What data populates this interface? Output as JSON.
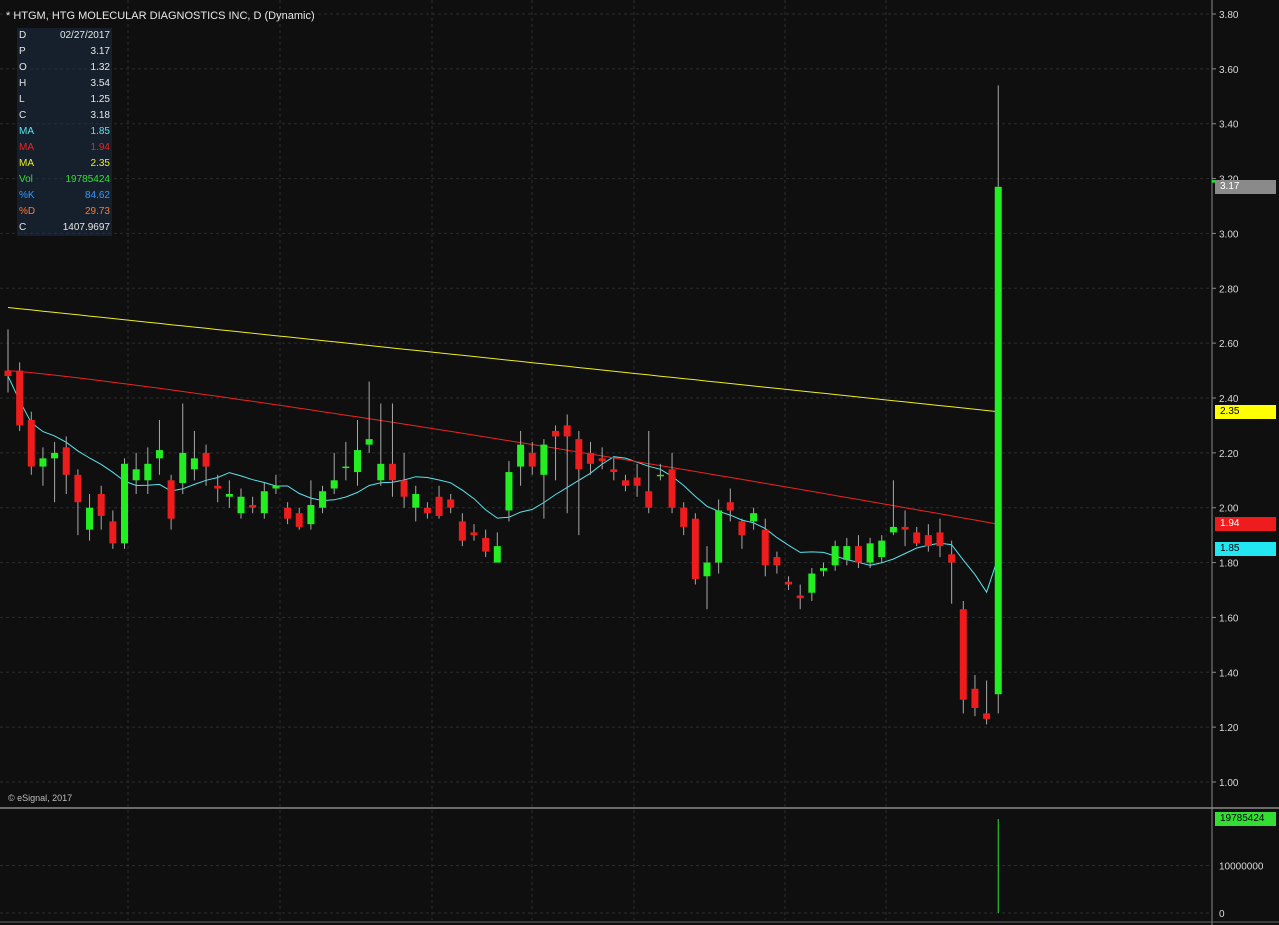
{
  "header": {
    "title": "* HTGM, HTG MOLECULAR DIAGNOSTICS INC, D (Dynamic)",
    "copyright": "© eSignal, 2017"
  },
  "info_panel": [
    {
      "label": "D",
      "value": "02/27/2017",
      "label_color": "#e6e6e6",
      "value_color": "#e6e6e6"
    },
    {
      "label": "P",
      "value": "3.17",
      "label_color": "#e6e6e6",
      "value_color": "#e6e6e6"
    },
    {
      "label": "O",
      "value": "1.32",
      "label_color": "#e6e6e6",
      "value_color": "#e6e6e6"
    },
    {
      "label": "H",
      "value": "3.54",
      "label_color": "#e6e6e6",
      "value_color": "#e6e6e6"
    },
    {
      "label": "L",
      "value": "1.25",
      "label_color": "#e6e6e6",
      "value_color": "#e6e6e6"
    },
    {
      "label": "C",
      "value": "3.18",
      "label_color": "#e6e6e6",
      "value_color": "#e6e6e6"
    },
    {
      "label": "MA",
      "value": "1.85",
      "label_color": "#55e6ee",
      "value_color": "#55e6ee"
    },
    {
      "label": "MA",
      "value": "1.94",
      "label_color": "#ee2222",
      "value_color": "#ee2222"
    },
    {
      "label": "MA",
      "value": "2.35",
      "label_color": "#eeee22",
      "value_color": "#eeee22"
    },
    {
      "label": "Vol",
      "value": "19785424",
      "label_color": "#33dd33",
      "value_color": "#33dd33"
    },
    {
      "label": "%K",
      "value": "84.62",
      "label_color": "#3399ff",
      "value_color": "#3399ff"
    },
    {
      "label": "%D",
      "value": "29.73",
      "label_color": "#ff7733",
      "value_color": "#ff7733"
    },
    {
      "label": "C",
      "value": "1407.9697",
      "label_color": "#e6e6e6",
      "value_color": "#e6e6e6"
    }
  ],
  "price_tags": [
    {
      "label": "3.17",
      "value": 3.17,
      "bg": "#8a8a8a",
      "fg": "#ffffff"
    },
    {
      "label": "2.35",
      "value": 2.35,
      "bg": "#ffff00",
      "fg": "#000000"
    },
    {
      "label": "1.94",
      "value": 1.94,
      "bg": "#ee1c1c",
      "fg": "#ffffff"
    },
    {
      "label": "1.85",
      "value": 1.85,
      "bg": "#22e6f2",
      "fg": "#000000"
    }
  ],
  "volume_tag": {
    "label": "19785424",
    "value": 19785424,
    "bg": "#33dd33",
    "fg": "#000000"
  },
  "colors": {
    "up": "#22ee22",
    "down": "#ee1c1c",
    "ma_short": "#55e6ee",
    "ma_mid": "#ee2222",
    "ma_long": "#eeee22",
    "volume": "#33dd33"
  },
  "chart_data": {
    "type": "candlestick",
    "price_axis": {
      "min": 1.0,
      "max": 3.8,
      "ticks": [
        "1.00",
        "1.20",
        "1.40",
        "1.60",
        "1.80",
        "2.00",
        "2.20",
        "2.40",
        "2.60",
        "2.80",
        "3.00",
        "3.20",
        "3.40",
        "3.60",
        "3.80"
      ]
    },
    "volume_axis": {
      "min": 0,
      "max": 20000000,
      "ticks": [
        "0",
        "10000000"
      ]
    },
    "grid": true,
    "candles": [
      [
        2.5,
        2.48,
        2.65,
        2.42
      ],
      [
        2.5,
        2.3,
        2.53,
        2.28
      ],
      [
        2.32,
        2.15,
        2.35,
        2.12
      ],
      [
        2.15,
        2.18,
        2.22,
        2.08
      ],
      [
        2.18,
        2.2,
        2.24,
        2.02
      ],
      [
        2.22,
        2.12,
        2.26,
        2.05
      ],
      [
        2.12,
        2.02,
        2.14,
        1.9
      ],
      [
        1.92,
        2.0,
        2.05,
        1.88
      ],
      [
        2.05,
        1.97,
        2.08,
        1.92
      ],
      [
        1.95,
        1.87,
        1.99,
        1.85
      ],
      [
        1.87,
        2.16,
        2.18,
        1.85
      ],
      [
        2.1,
        2.14,
        2.2,
        2.05
      ],
      [
        2.1,
        2.16,
        2.22,
        2.05
      ],
      [
        2.18,
        2.21,
        2.32,
        2.12
      ],
      [
        2.1,
        1.96,
        2.12,
        1.92
      ],
      [
        2.09,
        2.2,
        2.38,
        2.05
      ],
      [
        2.14,
        2.18,
        2.28,
        2.1
      ],
      [
        2.2,
        2.15,
        2.23,
        2.08
      ],
      [
        2.08,
        2.07,
        2.12,
        2.02
      ],
      [
        2.04,
        2.05,
        2.1,
        2.0
      ],
      [
        1.98,
        2.04,
        2.07,
        1.96
      ],
      [
        2.01,
        2.0,
        2.04,
        1.98
      ],
      [
        1.98,
        2.06,
        2.09,
        1.96
      ],
      [
        2.07,
        2.08,
        2.12,
        2.05
      ],
      [
        2.0,
        1.96,
        2.02,
        1.94
      ],
      [
        1.98,
        1.93,
        2.0,
        1.92
      ],
      [
        1.94,
        2.01,
        2.1,
        1.92
      ],
      [
        2.0,
        2.06,
        2.08,
        1.98
      ],
      [
        2.07,
        2.1,
        2.2,
        2.05
      ],
      [
        2.15,
        2.15,
        2.24,
        2.1
      ],
      [
        2.13,
        2.21,
        2.32,
        2.08
      ],
      [
        2.23,
        2.25,
        2.46,
        2.2
      ],
      [
        2.1,
        2.16,
        2.38,
        2.08
      ],
      [
        2.16,
        2.1,
        2.38,
        2.04
      ],
      [
        2.1,
        2.04,
        2.2,
        2.0
      ],
      [
        2.0,
        2.05,
        2.08,
        1.95
      ],
      [
        2.0,
        1.98,
        2.02,
        1.96
      ],
      [
        2.04,
        1.97,
        2.08,
        1.96
      ],
      [
        2.03,
        2.0,
        2.05,
        1.98
      ],
      [
        1.95,
        1.88,
        1.98,
        1.86
      ],
      [
        1.91,
        1.9,
        1.94,
        1.88
      ],
      [
        1.89,
        1.84,
        1.92,
        1.82
      ],
      [
        1.8,
        1.86,
        1.91,
        1.84
      ],
      [
        1.99,
        2.13,
        2.17,
        1.95
      ],
      [
        2.15,
        2.23,
        2.28,
        2.08
      ],
      [
        2.2,
        2.15,
        2.24,
        2.12
      ],
      [
        2.12,
        2.23,
        2.25,
        1.96
      ],
      [
        2.28,
        2.26,
        2.3,
        2.1
      ],
      [
        2.3,
        2.26,
        2.34,
        1.98
      ],
      [
        2.25,
        2.14,
        2.28,
        1.9
      ],
      [
        2.2,
        2.16,
        2.24,
        2.12
      ],
      [
        2.18,
        2.17,
        2.22,
        2.14
      ],
      [
        2.14,
        2.13,
        2.18,
        2.1
      ],
      [
        2.1,
        2.08,
        2.12,
        2.06
      ],
      [
        2.11,
        2.08,
        2.16,
        2.04
      ],
      [
        2.06,
        2.0,
        2.28,
        1.98
      ],
      [
        2.12,
        2.12,
        2.16,
        2.1
      ],
      [
        2.14,
        2.0,
        2.2,
        1.98
      ],
      [
        2.0,
        1.93,
        2.02,
        1.9
      ],
      [
        1.96,
        1.74,
        1.98,
        1.72
      ],
      [
        1.75,
        1.8,
        1.86,
        1.63
      ],
      [
        1.8,
        1.99,
        2.03,
        1.76
      ],
      [
        2.02,
        1.99,
        2.07,
        1.95
      ],
      [
        1.95,
        1.9,
        1.96,
        1.85
      ],
      [
        1.95,
        1.98,
        2.0,
        1.92
      ],
      [
        1.92,
        1.79,
        1.96,
        1.75
      ],
      [
        1.82,
        1.79,
        1.84,
        1.76
      ],
      [
        1.73,
        1.72,
        1.75,
        1.7
      ],
      [
        1.68,
        1.67,
        1.72,
        1.63
      ],
      [
        1.69,
        1.76,
        1.78,
        1.66
      ],
      [
        1.77,
        1.78,
        1.8,
        1.75
      ],
      [
        1.79,
        1.86,
        1.88,
        1.77
      ],
      [
        1.81,
        1.86,
        1.89,
        1.79
      ],
      [
        1.86,
        1.8,
        1.9,
        1.78
      ],
      [
        1.8,
        1.87,
        1.89,
        1.78
      ],
      [
        1.82,
        1.88,
        1.9,
        1.8
      ],
      [
        1.91,
        1.93,
        2.1,
        1.9
      ],
      [
        1.93,
        1.92,
        1.99,
        1.86
      ],
      [
        1.91,
        1.87,
        1.93,
        1.86
      ],
      [
        1.9,
        1.86,
        1.94,
        1.84
      ],
      [
        1.91,
        1.86,
        1.96,
        1.82
      ],
      [
        1.83,
        1.8,
        1.88,
        1.65
      ],
      [
        1.63,
        1.3,
        1.66,
        1.25
      ],
      [
        1.34,
        1.27,
        1.39,
        1.24
      ],
      [
        1.25,
        1.23,
        1.37,
        1.21
      ],
      [
        1.32,
        3.17,
        3.54,
        1.25
      ]
    ],
    "volume": [
      {
        "index": 85,
        "value": 19785424
      }
    ]
  }
}
